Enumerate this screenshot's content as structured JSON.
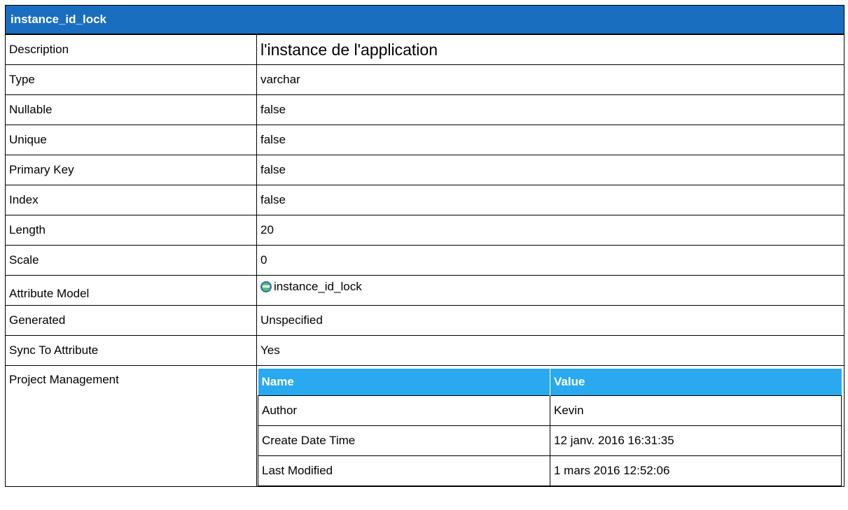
{
  "header": {
    "title": "instance_id_lock"
  },
  "rows": {
    "description": {
      "label": "Description",
      "value": "l'instance de l'application"
    },
    "type": {
      "label": "Type",
      "value": "varchar"
    },
    "nullable": {
      "label": "Nullable",
      "value": "false"
    },
    "unique": {
      "label": "Unique",
      "value": "false"
    },
    "primary_key": {
      "label": "Primary Key",
      "value": "false"
    },
    "index": {
      "label": "Index",
      "value": "false"
    },
    "length": {
      "label": "Length",
      "value": "20"
    },
    "scale": {
      "label": "Scale",
      "value": "0"
    },
    "attribute_model": {
      "label": "Attribute Model",
      "value": "instance_id_lock",
      "icon": "attribute-model-icon"
    },
    "generated": {
      "label": "Generated",
      "value": "Unspecified"
    },
    "sync_to_attribute": {
      "label": "Sync To Attribute",
      "value": "Yes"
    },
    "project_management": {
      "label": "Project Management"
    }
  },
  "project_management": {
    "columns": [
      "Name",
      "Value"
    ],
    "rows": [
      [
        "Author",
        "Kevin"
      ],
      [
        "Create Date Time",
        "12 janv. 2016 16:31:35"
      ],
      [
        "Last Modified",
        "1 mars 2016 12:52:06"
      ]
    ]
  },
  "colors": {
    "header_bg": "#1a6ec0",
    "subheader_bg": "#29a9f0"
  }
}
